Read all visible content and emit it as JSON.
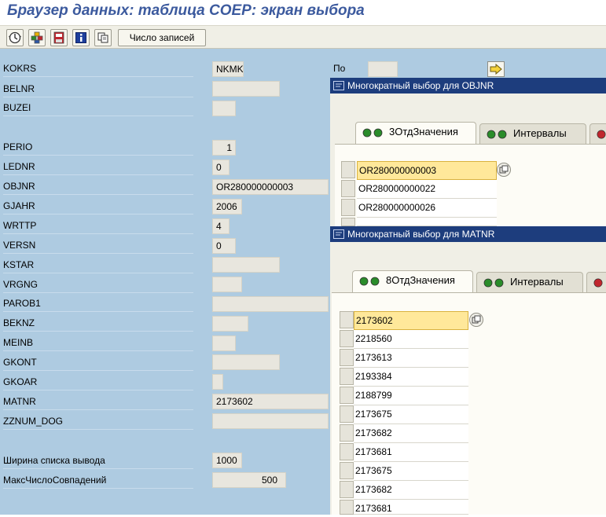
{
  "window": {
    "title": "Браузер данных: таблица COEP: экран выбора"
  },
  "toolbar": {
    "icons": [
      "execute-icon",
      "selection-options-icon",
      "save-variant-icon",
      "info-icon",
      "copy-icon"
    ],
    "record_count_button": "Число записей"
  },
  "fields": [
    {
      "label": "KOKRS",
      "value": "NKMK"
    },
    {
      "label": "BELNR",
      "value": ""
    },
    {
      "label": "BUZEI",
      "value": ""
    },
    {
      "label": "PERIO",
      "value": "1"
    },
    {
      "label": "LEDNR",
      "value": "0"
    },
    {
      "label": "OBJNR",
      "value": "OR280000000003"
    },
    {
      "label": "GJAHR",
      "value": "2006"
    },
    {
      "label": "WRTTP",
      "value": "4"
    },
    {
      "label": "VERSN",
      "value": "0"
    },
    {
      "label": "KSTAR",
      "value": ""
    },
    {
      "label": "VRGNG",
      "value": ""
    },
    {
      "label": "PAROB1",
      "value": ""
    },
    {
      "label": "BEKNZ",
      "value": ""
    },
    {
      "label": "MEINB",
      "value": ""
    },
    {
      "label": "GKONT",
      "value": ""
    },
    {
      "label": "GKOAR",
      "value": ""
    },
    {
      "label": "MATNR",
      "value": "2173602"
    },
    {
      "label": "ZZNUM_DOG",
      "value": ""
    }
  ],
  "range": {
    "to_label": "По",
    "to_value": ""
  },
  "settings": {
    "list_width_label": "Ширина списка вывода",
    "list_width_value": "1000",
    "max_hits_label": "МаксЧислоСовпадений",
    "max_hits_value": "500"
  },
  "popup_objnr": {
    "title": "Многократный выбор для OBJNR",
    "tabs": [
      "3ОтдЗначения",
      "Интервалы"
    ],
    "values": [
      "OR280000000003",
      "OR280000000022",
      "OR280000000026"
    ]
  },
  "popup_matnr": {
    "title": "Многократный выбор для MATNR",
    "tabs": [
      "8ОтдЗначения",
      "Интервалы"
    ],
    "values": [
      "2173602",
      "2218560",
      "2173613",
      "2193384",
      "2188799",
      "2173675",
      "2173682",
      "2173681",
      "2173675",
      "2173682",
      "2173681"
    ]
  },
  "colors": {
    "title": "#3c5a9e",
    "screen_background": "#aecbe1",
    "popup_title_bar": "#1d3d7d",
    "selected_row": "#ffe89a"
  }
}
